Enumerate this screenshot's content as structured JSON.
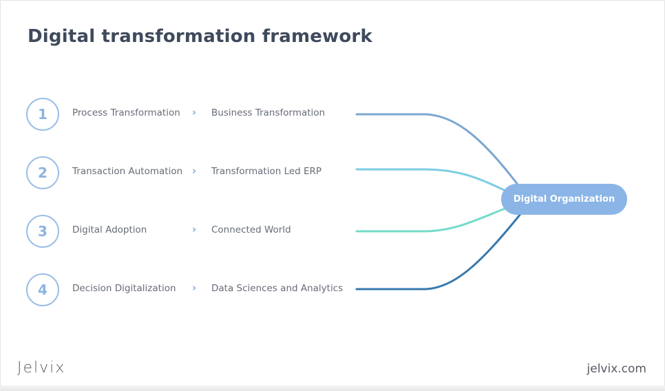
{
  "title": "Digital transformation framework",
  "steps": [
    {
      "number": "1",
      "from": "Process Transformation",
      "to": "Business Transformation",
      "connector_color": "#7ba7cf"
    },
    {
      "number": "2",
      "from": "Transaction Automation",
      "to": "Transformation Led ERP",
      "connector_color": "#7dcde2"
    },
    {
      "number": "3",
      "from": "Digital Adoption",
      "to": "Connected World",
      "connector_color": "#74dbc8"
    },
    {
      "number": "4",
      "from": "Decision Digitalization",
      "to": "Data Sciences and Analytics",
      "connector_color": "#3779ad"
    }
  ],
  "arrow_glyph": "›",
  "hub": {
    "label": "Digital Organization",
    "color": "#8ab5e6"
  },
  "footer": {
    "logo": "Jelvix",
    "site": "jelvix.com"
  }
}
